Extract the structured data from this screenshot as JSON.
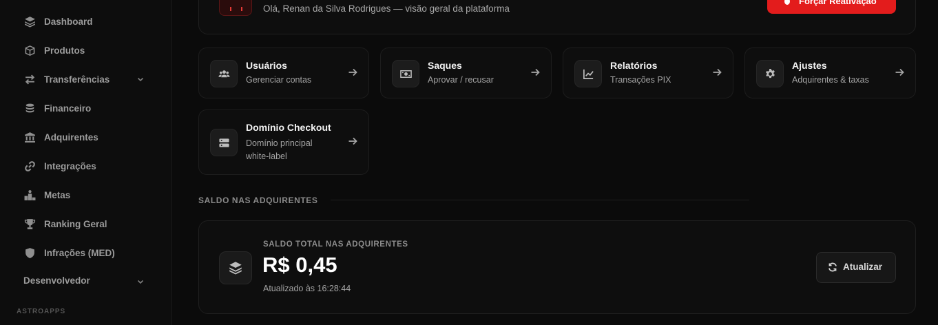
{
  "sidebar": {
    "items": [
      {
        "label": "Dashboard",
        "icon": "layers-icon"
      },
      {
        "label": "Produtos",
        "icon": "box-icon"
      },
      {
        "label": "Transferências",
        "icon": "transfer-icon",
        "expandable": true
      },
      {
        "label": "Financeiro",
        "icon": "coins-icon"
      },
      {
        "label": "Adquirentes",
        "icon": "bank-icon"
      },
      {
        "label": "Integrações",
        "icon": "link-icon"
      },
      {
        "label": "Metas",
        "icon": "podium-icon"
      },
      {
        "label": "Ranking Geral",
        "icon": "trophy-icon"
      },
      {
        "label": "Infrações (MED)",
        "icon": "shield-icon"
      }
    ],
    "developer_section": "Desenvolvedor",
    "group_label": "ASTROAPPS"
  },
  "header": {
    "subtitle": "Olá, Renan da Silva Rodrigues — visão geral da plataforma",
    "action_button": "Forçar Reativação"
  },
  "quick_links": [
    {
      "title": "Usuários",
      "subtitle": "Gerenciar contas",
      "icon": "users-icon"
    },
    {
      "title": "Saques",
      "subtitle": "Aprovar / recusar",
      "icon": "money-icon"
    },
    {
      "title": "Relatórios",
      "subtitle": "Transações PIX",
      "icon": "chart-line-icon"
    },
    {
      "title": "Ajustes",
      "subtitle": "Adquirentes & taxas",
      "icon": "gear-icon"
    },
    {
      "title": "Domínio Checkout",
      "subtitle_line1": "Domínio principal",
      "subtitle_line2": "white-label",
      "icon": "server-icon"
    }
  ],
  "balance_section": {
    "title": "SALDO NAS ADQUIRENTES",
    "label": "SALDO TOTAL NAS ADQUIRENTES",
    "value": "R$ 0,45",
    "updated": "Atualizado às 16:28:44",
    "refresh_button": "Atualizar"
  },
  "colors": {
    "accent": "#e31c1c",
    "background": "#0b0b0b",
    "card": "#0e0e0e"
  }
}
